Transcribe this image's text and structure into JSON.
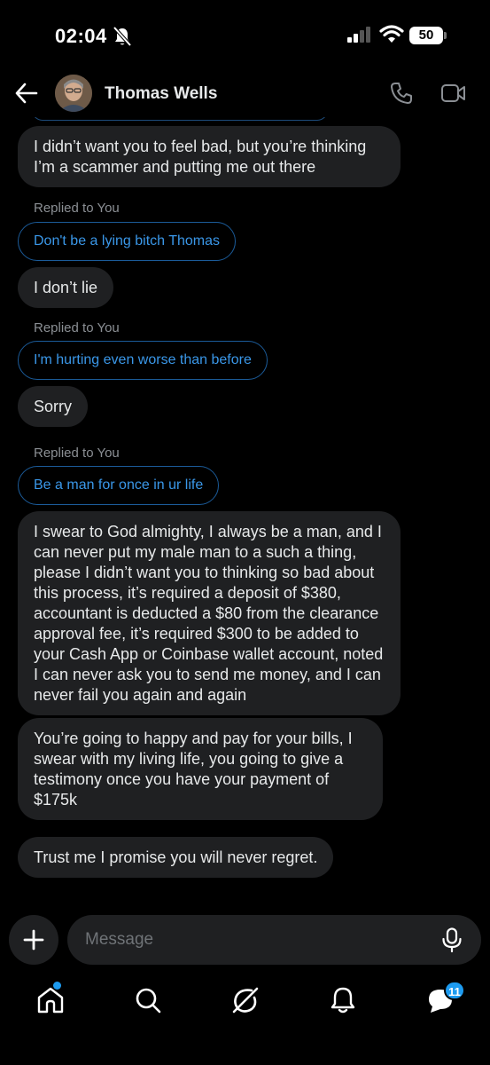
{
  "status_bar": {
    "time": "02:04",
    "battery": "50"
  },
  "header": {
    "contact_name": "Thomas Wells"
  },
  "messages": [
    {
      "type": "bubble",
      "text": "I didn’t want you to feel bad, but you’re thinking I’m a scammer and putting me out there"
    },
    {
      "type": "reply",
      "label": "Replied to You",
      "quoted": "Don't be a lying bitch Thomas"
    },
    {
      "type": "bubble",
      "text": "I don’t lie"
    },
    {
      "type": "reply",
      "label": "Replied to You",
      "quoted": "I'm hurting even worse than before"
    },
    {
      "type": "bubble",
      "text": "Sorry"
    },
    {
      "type": "reply",
      "label": "Replied to You",
      "quoted": "Be a man for once in ur life"
    },
    {
      "type": "bubble",
      "text": "I swear to God almighty, I always be a man, and I can never put my male man to a such a thing, please I didn’t want you to thinking so bad about this process, it’s required a deposit of $380, accountant is deducted a $80 from the clearance approval fee, it’s required $300 to be added to your Cash App or Coinbase wallet account, noted I can never ask you to send me money, and I can never fail you again and again"
    },
    {
      "type": "bubble",
      "text": "You’re going to happy and pay for your bills, I swear with my living life, you going to give a testimony once you have your payment of $175k"
    },
    {
      "type": "bubble",
      "text": "Trust me I promise you will never regret."
    }
  ],
  "composer": {
    "placeholder": "Message"
  },
  "nav": {
    "messages_badge": "11"
  },
  "icons": [
    "bell-off-icon",
    "signal-icon",
    "wifi-icon",
    "back-arrow-icon",
    "phone-icon",
    "video-icon",
    "plus-icon",
    "mic-icon",
    "home-icon",
    "search-icon",
    "grok-icon",
    "notifications-icon",
    "messages-icon"
  ],
  "colors": {
    "accent": "#1d9bf0",
    "bubble": "#1f2022",
    "reply_border": "#1b5b99",
    "reply_text": "#3a97e8"
  }
}
